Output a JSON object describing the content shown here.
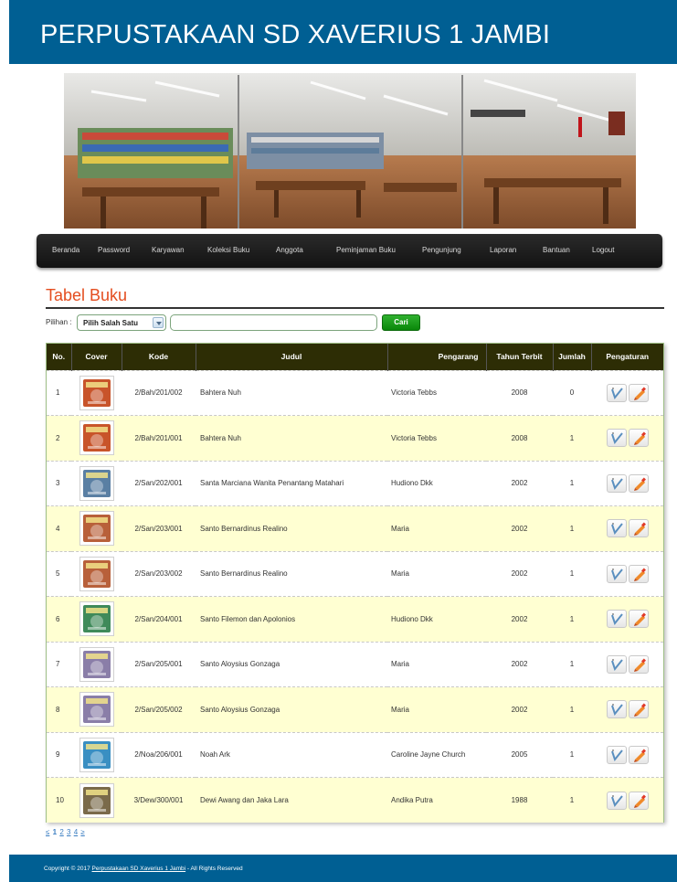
{
  "header": {
    "title": "PERPUSTAKAAN SD XAVERIUS 1 JAMBI"
  },
  "nav": {
    "items": [
      "Beranda",
      "Password",
      "Karyawan",
      "Koleksi Buku",
      "Anggota",
      "Peminjaman Buku",
      "Pengunjung",
      "Laporan",
      "Bantuan",
      "Logout"
    ]
  },
  "section": {
    "title": "Tabel Buku"
  },
  "filter": {
    "label": "Pilihan :",
    "select_value": "Pilih Salah Satu",
    "input_value": "",
    "button_label": "Cari"
  },
  "table": {
    "headers": [
      "No.",
      "Cover",
      "Kode",
      "Judul",
      "Pengarang",
      "Tahun Terbit",
      "Jumlah",
      "Pengaturan"
    ],
    "rows": [
      {
        "no": "1",
        "kode": "2/Bah/201/002",
        "judul": "Bahtera Nuh",
        "pengarang": "Victoria Tebbs",
        "tahun": "2008",
        "jumlah": "0"
      },
      {
        "no": "2",
        "kode": "2/Bah/201/001",
        "judul": "Bahtera Nuh",
        "pengarang": "Victoria Tebbs",
        "tahun": "2008",
        "jumlah": "1"
      },
      {
        "no": "3",
        "kode": "2/San/202/001",
        "judul": "Santa Marciana Wanita Penantang Matahari",
        "pengarang": "Hudiono Dkk",
        "tahun": "2002",
        "jumlah": "1"
      },
      {
        "no": "4",
        "kode": "2/San/203/001",
        "judul": "Santo Bernardinus Realino",
        "pengarang": "Maria",
        "tahun": "2002",
        "jumlah": "1"
      },
      {
        "no": "5",
        "kode": "2/San/203/002",
        "judul": "Santo Bernardinus Realino",
        "pengarang": "Maria",
        "tahun": "2002",
        "jumlah": "1"
      },
      {
        "no": "6",
        "kode": "2/San/204/001",
        "judul": "Santo Filemon dan Apolonios",
        "pengarang": "Hudiono Dkk",
        "tahun": "2002",
        "jumlah": "1"
      },
      {
        "no": "7",
        "kode": "2/San/205/001",
        "judul": "Santo Aloysius Gonzaga",
        "pengarang": "Maria",
        "tahun": "2002",
        "jumlah": "1"
      },
      {
        "no": "8",
        "kode": "2/San/205/002",
        "judul": "Santo Aloysius Gonzaga",
        "pengarang": "Maria",
        "tahun": "2002",
        "jumlah": "1"
      },
      {
        "no": "9",
        "kode": "2/Noa/206/001",
        "judul": "Noah Ark",
        "pengarang": "Caroline Jayne Church",
        "tahun": "2005",
        "jumlah": "1"
      },
      {
        "no": "10",
        "kode": "3/Dew/300/001",
        "judul": "Dewi Awang dan Jaka Lara",
        "pengarang": "Andika Putra",
        "tahun": "1988",
        "jumlah": "1"
      }
    ],
    "cover_colors": [
      "#c8542a",
      "#c8542a",
      "#5a7fa3",
      "#b8603a",
      "#b8603a",
      "#3f8a5a",
      "#8a7ea8",
      "#8a7ea8",
      "#3a8fc2",
      "#7a6a4a"
    ]
  },
  "pager": {
    "prev": "≤",
    "pages": [
      "1",
      "2",
      "3",
      "4"
    ],
    "current": "1",
    "next": "≥"
  },
  "footer": {
    "prefix": "Copyright © 2017",
    "link": "Perpustakaan SD Xaverius 1 Jambi",
    "suffix": "- All Rights Reserved"
  },
  "icons": {
    "edit": "edit-icon",
    "delete": "delete-icon"
  }
}
